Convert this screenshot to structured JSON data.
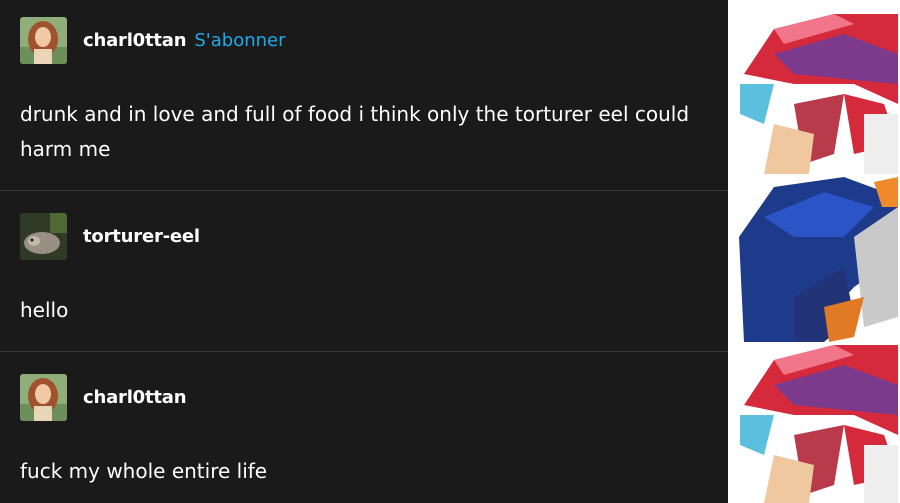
{
  "posts": [
    {
      "username": "charl0ttan",
      "follow_label": "S'abonner",
      "avatar_icon": "woman-portrait-icon",
      "text": "drunk and in love and full of food i think only the torturer eel could harm me"
    },
    {
      "username": "torturer-eel",
      "avatar_icon": "eel-icon",
      "text": "hello"
    },
    {
      "username": "charl0ttan",
      "avatar_icon": "woman-portrait-icon",
      "text": "fuck my whole entire life"
    }
  ],
  "colors": {
    "background": "#1a1a1a",
    "follow_link": "#1faaed",
    "divider": "#3a3a3a"
  },
  "side_panel": {
    "frames": [
      "red-helmet-character",
      "blue-helmet-character",
      "red-helmet-character"
    ]
  }
}
